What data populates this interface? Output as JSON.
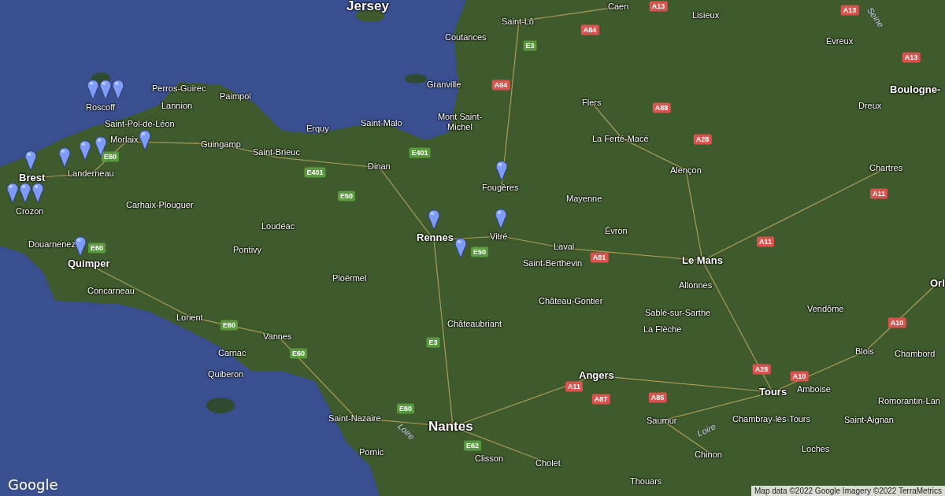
{
  "map": {
    "places": [
      {
        "name": "Jersey",
        "kind": "large"
      },
      {
        "name": "Caen",
        "kind": "small"
      },
      {
        "name": "Lisieux",
        "kind": "small"
      },
      {
        "name": "Saint-Lô",
        "kind": "small"
      },
      {
        "name": "Coutances",
        "kind": "small"
      },
      {
        "name": "Évreux",
        "kind": "small"
      },
      {
        "name": "Granville",
        "kind": "small"
      },
      {
        "name": "Perros-Guirec",
        "kind": "small"
      },
      {
        "name": "Boulogne-",
        "kind": "medium"
      },
      {
        "name": "Paimpol",
        "kind": "small"
      },
      {
        "name": "Flers",
        "kind": "small"
      },
      {
        "name": "Roscoff",
        "kind": "small"
      },
      {
        "name": "Lannion",
        "kind": "small"
      },
      {
        "name": "Dreux",
        "kind": "small"
      },
      {
        "name": "Saint-Pol-de-Léon",
        "kind": "small"
      },
      {
        "name": "Saint-Malo",
        "kind": "small"
      },
      {
        "name": "Mont Saint-Michel",
        "kind": "small"
      },
      {
        "name": "Erquy",
        "kind": "small"
      },
      {
        "name": "La Ferté-Macé",
        "kind": "small"
      },
      {
        "name": "Morlaix",
        "kind": "small"
      },
      {
        "name": "Guingamp",
        "kind": "small"
      },
      {
        "name": "Saint-Brieuc",
        "kind": "small"
      },
      {
        "name": "Brest",
        "kind": "medium"
      },
      {
        "name": "Landerneau",
        "kind": "small"
      },
      {
        "name": "Dinan",
        "kind": "small"
      },
      {
        "name": "Alençon",
        "kind": "small"
      },
      {
        "name": "Chartres",
        "kind": "small"
      },
      {
        "name": "Fougères",
        "kind": "small"
      },
      {
        "name": "Crozon",
        "kind": "small"
      },
      {
        "name": "Carhaix-Plouguer",
        "kind": "small"
      },
      {
        "name": "Mayenne",
        "kind": "small"
      },
      {
        "name": "Loudéac",
        "kind": "small"
      },
      {
        "name": "Douarnenez",
        "kind": "small"
      },
      {
        "name": "Rennes",
        "kind": "medium"
      },
      {
        "name": "Vitré",
        "kind": "small"
      },
      {
        "name": "Évron",
        "kind": "small"
      },
      {
        "name": "Pontivy",
        "kind": "small"
      },
      {
        "name": "Laval",
        "kind": "small"
      },
      {
        "name": "Quimper",
        "kind": "medium"
      },
      {
        "name": "Saint-Berthevin",
        "kind": "small"
      },
      {
        "name": "Le Mans",
        "kind": "medium"
      },
      {
        "name": "Ploërmel",
        "kind": "small"
      },
      {
        "name": "Concarneau",
        "kind": "small"
      },
      {
        "name": "Allonnes",
        "kind": "small"
      },
      {
        "name": "Orl",
        "kind": "medium"
      },
      {
        "name": "Château-Gontier",
        "kind": "small"
      },
      {
        "name": "Lorient",
        "kind": "small"
      },
      {
        "name": "Sablé-sur-Sarthe",
        "kind": "small"
      },
      {
        "name": "Vendôme",
        "kind": "small"
      },
      {
        "name": "Châteaubriant",
        "kind": "small"
      },
      {
        "name": "Vannes",
        "kind": "small"
      },
      {
        "name": "La Flèche",
        "kind": "small"
      },
      {
        "name": "Carnac",
        "kind": "small"
      },
      {
        "name": "Blois",
        "kind": "small"
      },
      {
        "name": "Chambord",
        "kind": "small"
      },
      {
        "name": "Quiberon",
        "kind": "small"
      },
      {
        "name": "Angers",
        "kind": "medium"
      },
      {
        "name": "Tours",
        "kind": "medium"
      },
      {
        "name": "Amboise",
        "kind": "small"
      },
      {
        "name": "Romorantin-Lan",
        "kind": "small"
      },
      {
        "name": "Saint-Nazaire",
        "kind": "small"
      },
      {
        "name": "Nantes",
        "kind": "large"
      },
      {
        "name": "Saumur",
        "kind": "small"
      },
      {
        "name": "Chambray-lès-Tours",
        "kind": "small"
      },
      {
        "name": "Saint-Aignan",
        "kind": "small"
      },
      {
        "name": "Pornic",
        "kind": "small"
      },
      {
        "name": "Clisson",
        "kind": "small"
      },
      {
        "name": "Cholet",
        "kind": "small"
      },
      {
        "name": "Chinon",
        "kind": "small"
      },
      {
        "name": "Loches",
        "kind": "small"
      },
      {
        "name": "Thouars",
        "kind": "small"
      }
    ],
    "rivers": [
      {
        "name": "Seine"
      },
      {
        "name": "Loire"
      },
      {
        "name": "Loire"
      }
    ],
    "road_shields": [
      {
        "label": "A13",
        "kind": "motorway"
      },
      {
        "label": "A13",
        "kind": "motorway"
      },
      {
        "label": "A84",
        "kind": "motorway"
      },
      {
        "label": "E3",
        "kind": "european"
      },
      {
        "label": "A13",
        "kind": "motorway"
      },
      {
        "label": "A84",
        "kind": "motorway"
      },
      {
        "label": "A88",
        "kind": "motorway"
      },
      {
        "label": "A28",
        "kind": "motorway"
      },
      {
        "label": "E401",
        "kind": "european"
      },
      {
        "label": "E60",
        "kind": "european"
      },
      {
        "label": "E401",
        "kind": "european"
      },
      {
        "label": "A11",
        "kind": "motorway"
      },
      {
        "label": "E50",
        "kind": "european"
      },
      {
        "label": "A11",
        "kind": "motorway"
      },
      {
        "label": "E50",
        "kind": "european"
      },
      {
        "label": "A81",
        "kind": "motorway"
      },
      {
        "label": "E60",
        "kind": "european"
      },
      {
        "label": "A10",
        "kind": "motorway"
      },
      {
        "label": "E60",
        "kind": "european"
      },
      {
        "label": "E3",
        "kind": "european"
      },
      {
        "label": "E60",
        "kind": "european"
      },
      {
        "label": "A28",
        "kind": "motorway"
      },
      {
        "label": "A10",
        "kind": "motorway"
      },
      {
        "label": "A11",
        "kind": "motorway"
      },
      {
        "label": "A85",
        "kind": "motorway"
      },
      {
        "label": "A87",
        "kind": "motorway"
      },
      {
        "label": "E60",
        "kind": "european"
      },
      {
        "label": "E62",
        "kind": "european"
      }
    ],
    "markers": [
      {
        "kind": "pin"
      },
      {
        "kind": "pin"
      },
      {
        "kind": "pin"
      },
      {
        "kind": "pin"
      },
      {
        "kind": "pin"
      },
      {
        "kind": "pin"
      },
      {
        "kind": "pin"
      },
      {
        "kind": "pin"
      },
      {
        "kind": "pin"
      },
      {
        "kind": "pin"
      },
      {
        "kind": "pin"
      },
      {
        "kind": "pin"
      },
      {
        "kind": "pin"
      },
      {
        "kind": "pin"
      },
      {
        "kind": "pin"
      },
      {
        "kind": "pin"
      }
    ],
    "logo": "Google",
    "attribution": "Map data ©2022 Google Imagery ©2022 TerraMetrics"
  }
}
